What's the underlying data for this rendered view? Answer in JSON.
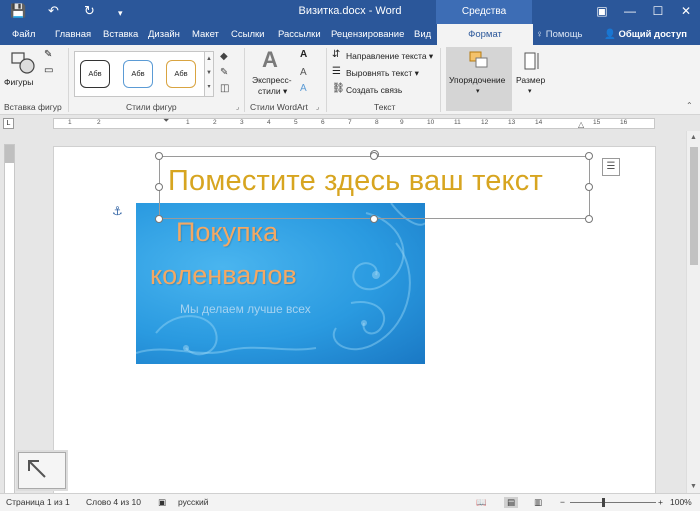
{
  "window": {
    "title": "Визитка.docx - Word",
    "context_tools": "Средства рисования",
    "controls": [
      "▣",
      "—",
      "☐",
      "✕"
    ]
  },
  "quick_access": {
    "save": "💾",
    "undo": "↶",
    "redo": "↻",
    "more": "▾"
  },
  "tabs": [
    "Файл",
    "Главная",
    "Вставка",
    "Дизайн",
    "Макет",
    "Ссылки",
    "Рассылки",
    "Рецензирование",
    "Вид",
    "Формат"
  ],
  "help": "♀ Помощь",
  "share": "Общий доступ",
  "ribbon": {
    "insert_shapes": {
      "button": "Фигуры",
      "label": "Вставка фигур"
    },
    "shape_styles": {
      "samples": [
        "Абв",
        "Абв",
        "Абв"
      ],
      "sample_colors": [
        "#333333",
        "#5b9bd5",
        "#d9a441"
      ],
      "label": "Стили фигур"
    },
    "wordart": {
      "button_line1": "Экспресс-",
      "button_line2": "стили ▾",
      "label": "Стили WordArt"
    },
    "text": {
      "direction": "Направление текста ▾",
      "align": "Выровнять текст ▾",
      "link": "Создать связь",
      "label": "Текст"
    },
    "arrange": {
      "button": "Упорядочение"
    },
    "size": {
      "button": "Размер"
    }
  },
  "ruler": {
    "ticks": [
      "1",
      "2",
      "1",
      "2",
      "3",
      "4",
      "5",
      "6",
      "7",
      "8",
      "9",
      "10",
      "11",
      "12",
      "13",
      "14",
      "15",
      "16"
    ]
  },
  "document": {
    "textbox": "Поместите здесь ваш текст",
    "card": {
      "title_line1": "Покупка",
      "title_line2": "коленвалов",
      "slogan": "Мы делаем лучше всех"
    }
  },
  "statusbar": {
    "page": "Страница 1 из 1",
    "words": "Слово 4 из 10",
    "lang": "русский",
    "zoom": "100%",
    "zoom_value": 100
  }
}
